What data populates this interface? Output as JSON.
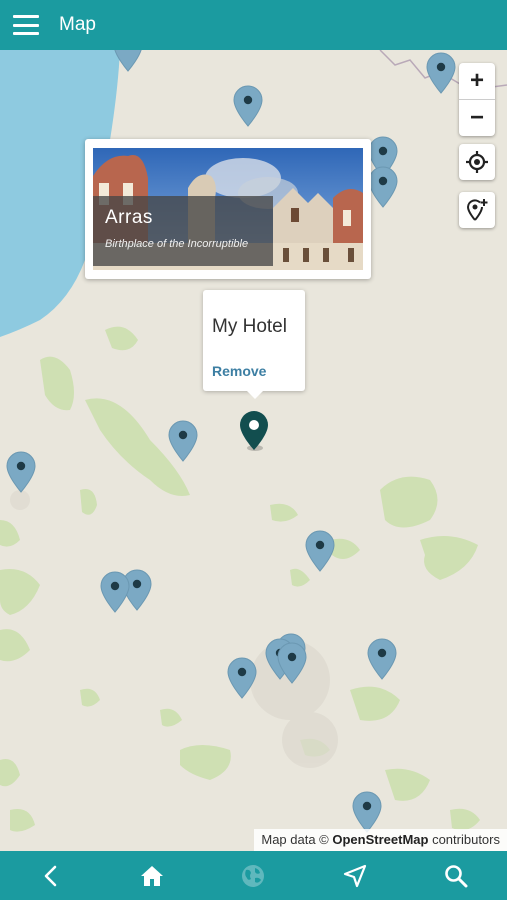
{
  "header": {
    "title": "Map"
  },
  "popup": {
    "title": "Arras",
    "subtitle": "Birthplace of the Incorruptible"
  },
  "hotel": {
    "name": "My Hotel",
    "remove_label": "Remove"
  },
  "zoom": {
    "in_label": "+",
    "out_label": "−"
  },
  "attribution": {
    "prefix": "Map data © ",
    "source": "OpenStreetMap",
    "suffix": " contributors"
  },
  "colors": {
    "bar": "#1b9ba0",
    "pin": "#7ba9c4",
    "hotel_pin": "#124e4f",
    "sea": "#8ecae0",
    "land": "#e9e6dc",
    "forest": "#cfe0b3"
  },
  "bottom_nav": [
    "back-icon",
    "home-icon",
    "globe-icon",
    "navigation-arrow-icon",
    "search-icon"
  ]
}
